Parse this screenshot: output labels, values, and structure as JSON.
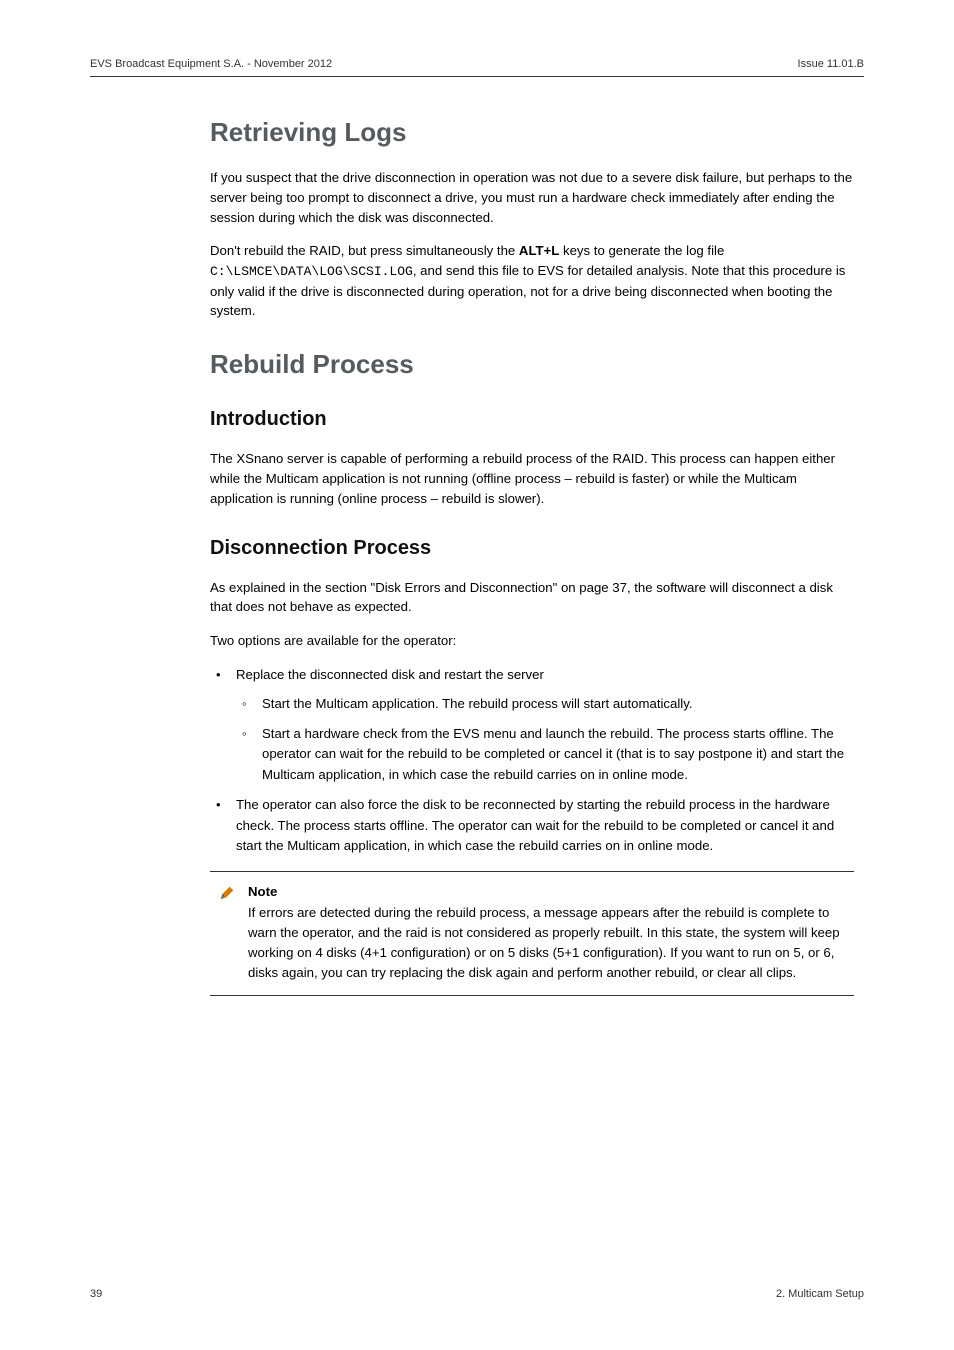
{
  "header": {
    "left": "EVS Broadcast Equipment S.A.  - November 2012",
    "right": "Issue 11.01.B"
  },
  "sections": {
    "retrieving_logs": {
      "title": "Retrieving Logs",
      "p1": "If you suspect that the drive disconnection in operation was not due to a severe disk failure, but perhaps to the server being too prompt to disconnect a drive, you must run a hardware check immediately after ending the session during which the disk was disconnected.",
      "p2a": "Don't rebuild the RAID, but press simultaneously the ",
      "p2_bold": "ALT+L",
      "p2b": " keys to generate the log file ",
      "p2_mono": "C:\\LSMCE\\DATA\\LOG\\SCSI.LOG",
      "p2c": ", and send this file to EVS for detailed analysis. Note that this procedure is only valid if the drive is disconnected during operation, not for a drive being disconnected when booting the system."
    },
    "rebuild_process": {
      "title": "Rebuild Process",
      "intro": {
        "title": "Introduction",
        "p1": "The XSnano server is capable of performing a rebuild process of the RAID. This process can happen either while the Multicam application is not running (offline process – rebuild is faster) or while the Multicam application is running (online process – rebuild is slower)."
      },
      "disc": {
        "title": "Disconnection Process",
        "p1": "As explained in the section \"Disk Errors and Disconnection\" on page 37, the software will disconnect a disk that does not behave as expected.",
        "p2": "Two options are available for the operator:",
        "b1_lead": "Replace the disconnected disk and restart the server",
        "b1_sub1": "Start the Multicam application. The rebuild process will start automatically.",
        "b1_sub2": "Start a hardware check from the EVS menu and launch the rebuild. The process starts offline. The operator can wait for the rebuild to be completed or cancel it (that is to say postpone it) and start the Multicam application, in which case the rebuild carries on in online mode.",
        "b2": "The operator can also force the disk to be reconnected by starting the rebuild process in the hardware check. The process starts offline. The operator can wait for the rebuild to be completed or cancel it and start the Multicam application, in which case the rebuild carries on in online mode."
      },
      "note": {
        "title": "Note",
        "body": "If errors are detected during the rebuild process, a message appears after the rebuild is complete to warn the operator, and the raid is not considered as properly rebuilt. In this state, the system will keep working on 4 disks (4+1 configuration) or on 5 disks (5+1 configuration). If you want to run on 5, or 6, disks again, you can try replacing the disk again and perform another rebuild, or clear all clips."
      }
    }
  },
  "footer": {
    "left": "39",
    "right": "2. Multicam Setup"
  }
}
